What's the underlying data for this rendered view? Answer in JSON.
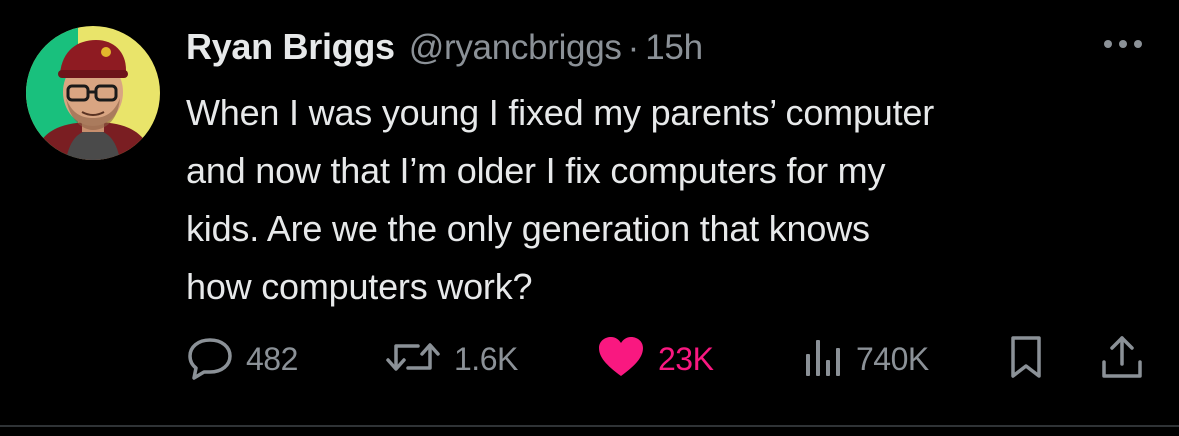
{
  "author": {
    "display_name": "Ryan Briggs",
    "handle": "@ryancbriggs",
    "separator": "·",
    "time": "15h"
  },
  "tweet": {
    "lines": [
      "When I was young I fixed my parents’ computer",
      "and now that I’m older I fix computers for my",
      "kids. Are we the only generation that knows",
      "how computers work?"
    ]
  },
  "actions": {
    "replies": "482",
    "retweets": "1.6K",
    "likes": "23K",
    "views": "740K"
  },
  "icons": {
    "more": "more-horizontal-icon",
    "reply": "speech-bubble-icon",
    "retweet": "retweet-arrows-icon",
    "like": "heart-icon",
    "views": "bar-chart-icon",
    "bookmark": "bookmark-icon",
    "share": "share-upload-icon"
  },
  "colors": {
    "background": "#000000",
    "text": "#e7e9ea",
    "secondary": "#8b9197",
    "like_accent": "#f91880"
  }
}
